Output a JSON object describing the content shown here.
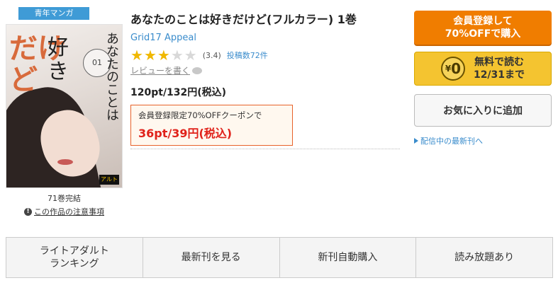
{
  "book": {
    "genre_badge": "青年マンガ",
    "cover_title_main": "だけど",
    "cover_title_like": "好き",
    "cover_title_side": "あなたのことは",
    "cover_volume": "01",
    "cover_publisher_logo": "アルト",
    "volume_note": "71巻完結",
    "caution_link": "この作品の注意事項",
    "title": "あなたのことは好きだけど(フルカラー) 1巻",
    "author": "Grid17 Appeal",
    "rating": {
      "stars_filled": 3,
      "stars_total": 5,
      "value_text": "(3.4)",
      "review_count_text": "投稿数72件"
    },
    "review_link": "レビューを書く",
    "price": "120pt/132円(税込)",
    "coupon": {
      "title": "会員登録限定70%OFFクーポンで",
      "price": "36pt/39円(税込)"
    }
  },
  "actions": {
    "member_button_line1": "会員登録して",
    "member_button_line2": "70%OFFで購入",
    "free_read_line1": "無料で読む",
    "free_read_line2": "12/31まで",
    "free_coin_text": "0",
    "favorite_button": "お気に入りに追加",
    "latest_link": "配信中の最新刊へ"
  },
  "bottom_tabs": [
    {
      "label_line1": "ライトアダルト",
      "label_line2": "ランキング"
    },
    {
      "label_line1": "最新刊を見る",
      "label_line2": ""
    },
    {
      "label_line1": "新刊自動購入",
      "label_line2": ""
    },
    {
      "label_line1": "読み放題あり",
      "label_line2": ""
    }
  ],
  "colors": {
    "accent_orange": "#f07d00",
    "accent_yellow": "#f4c430",
    "link_blue": "#3a8ccc",
    "price_red": "#e0221a",
    "badge_blue": "#3f9bd6"
  }
}
